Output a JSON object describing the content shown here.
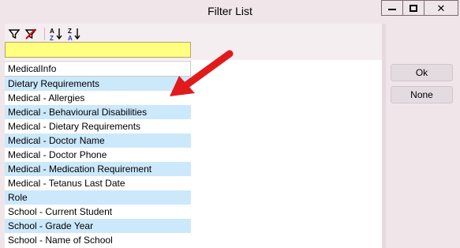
{
  "window": {
    "title": "Filter List",
    "controls": {
      "minimize": "minimize-icon",
      "maximize": "maximize-icon",
      "close": "close-icon"
    }
  },
  "toolbar": {
    "icons": [
      "filter-icon",
      "clear-filter-icon",
      "sort-ascending-icon",
      "sort-descending-icon"
    ],
    "sort_asc_top": "A",
    "sort_asc_bottom": "Z",
    "sort_desc_top": "Z",
    "sort_desc_bottom": "A"
  },
  "filter": {
    "value": "",
    "highlight_color": "#ffff80"
  },
  "list": {
    "header": "MedicalInfo",
    "items": [
      "Dietary Requirements",
      "Medical - Allergies",
      "Medical - Behavioural Disabilities",
      "Medical - Dietary Requirements",
      "Medical - Doctor Name",
      "Medical - Doctor Phone",
      "Medical - Medication Requirement",
      "Medical - Tetanus Last Date",
      "Role",
      "School - Current Student",
      "School - Grade Year",
      "School - Name of School"
    ],
    "alt_row_color": "#cce8fb"
  },
  "buttons": {
    "ok": "Ok",
    "none": "None"
  },
  "annotation": {
    "arrow_color": "#e11b1b"
  }
}
